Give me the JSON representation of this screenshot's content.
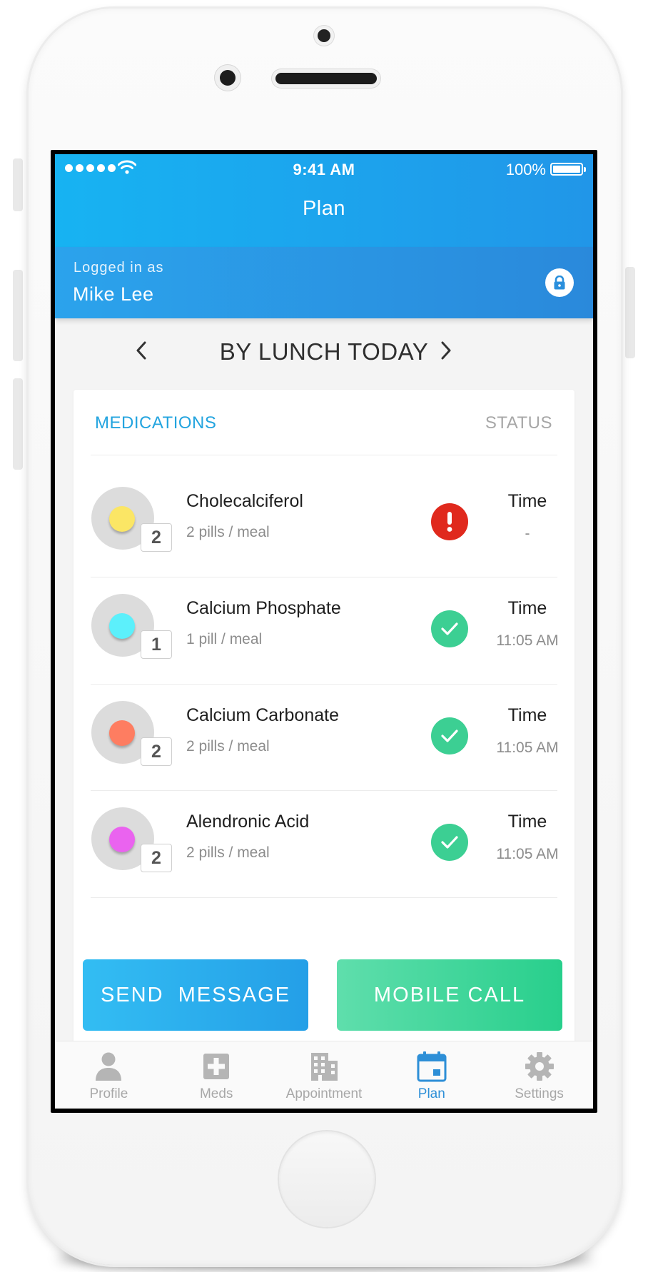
{
  "status_bar": {
    "time": "9:41 AM",
    "battery": "100%"
  },
  "header": {
    "title": "Plan"
  },
  "user": {
    "logged_in_label": "Logged in as",
    "name": "Mike Lee"
  },
  "period": {
    "title": "BY LUNCH TODAY"
  },
  "table": {
    "col_medications": "MEDICATIONS",
    "col_status": "STATUS"
  },
  "medications": [
    {
      "name": "Cholecalciferol",
      "dose": "2 pills / meal",
      "count": "2",
      "pill_color": "#fbe665",
      "status": "warning",
      "time_label": "Time",
      "time_value": "-"
    },
    {
      "name": "Calcium Phosphate",
      "dose": "1 pill / meal",
      "count": "1",
      "pill_color": "#5cf0fb",
      "status": "taken",
      "time_label": "Time",
      "time_value": "11:05 AM"
    },
    {
      "name": "Calcium Carbonate",
      "dose": "2 pills / meal",
      "count": "2",
      "pill_color": "#fe7d61",
      "status": "taken",
      "time_label": "Time",
      "time_value": "11:05 AM"
    },
    {
      "name": "Alendronic Acid",
      "dose": "2 pills / meal",
      "count": "2",
      "pill_color": "#ea63ef",
      "status": "taken",
      "time_label": "Time",
      "time_value": "11:05 AM"
    }
  ],
  "actions": {
    "send_message": "SEND  MESSAGE",
    "mobile_call": "MOBILE CALL"
  },
  "tabs": [
    {
      "label": "Profile",
      "icon": "person-icon",
      "active": false
    },
    {
      "label": "Meds",
      "icon": "medical-cross-icon",
      "active": false
    },
    {
      "label": "Appointment",
      "icon": "building-icon",
      "active": false
    },
    {
      "label": "Plan",
      "icon": "calendar-icon",
      "active": true
    },
    {
      "label": "Settings",
      "icon": "gear-icon",
      "active": false
    }
  ],
  "colors": {
    "header_blue": "#17b3f2",
    "accent_blue": "#23a4df",
    "warning_red": "#e0291d",
    "ok_green": "#3ccf93",
    "tab_active": "#2d8fd7"
  }
}
